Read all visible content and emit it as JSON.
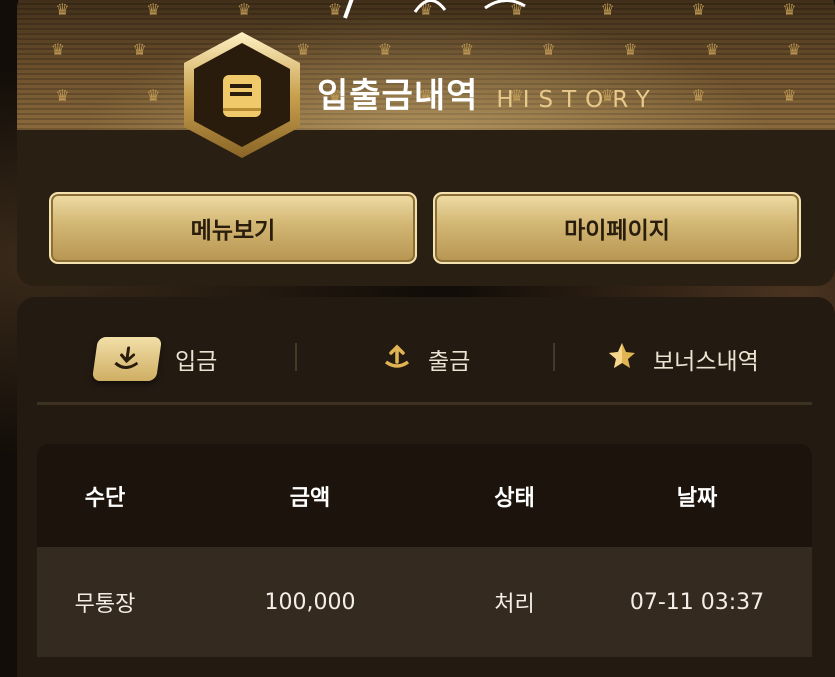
{
  "header": {
    "title_ko": "입출금내역",
    "title_en": "HISTORY",
    "menu_button": "메뉴보기",
    "mypage_button": "마이페이지"
  },
  "tabs": [
    {
      "label": "입금",
      "icon": "download-icon",
      "active": true
    },
    {
      "label": "출금",
      "icon": "upload-icon",
      "active": false
    },
    {
      "label": "보너스내역",
      "icon": "star-icon",
      "active": false
    }
  ],
  "table": {
    "headers": [
      "수단",
      "금액",
      "상태",
      "날짜"
    ],
    "rows": [
      [
        "무통장",
        "100,000",
        "처리",
        "07-11 03:37"
      ]
    ]
  },
  "colors": {
    "gold": "#d2b673",
    "background": "#120d08",
    "card": "#231a12"
  }
}
